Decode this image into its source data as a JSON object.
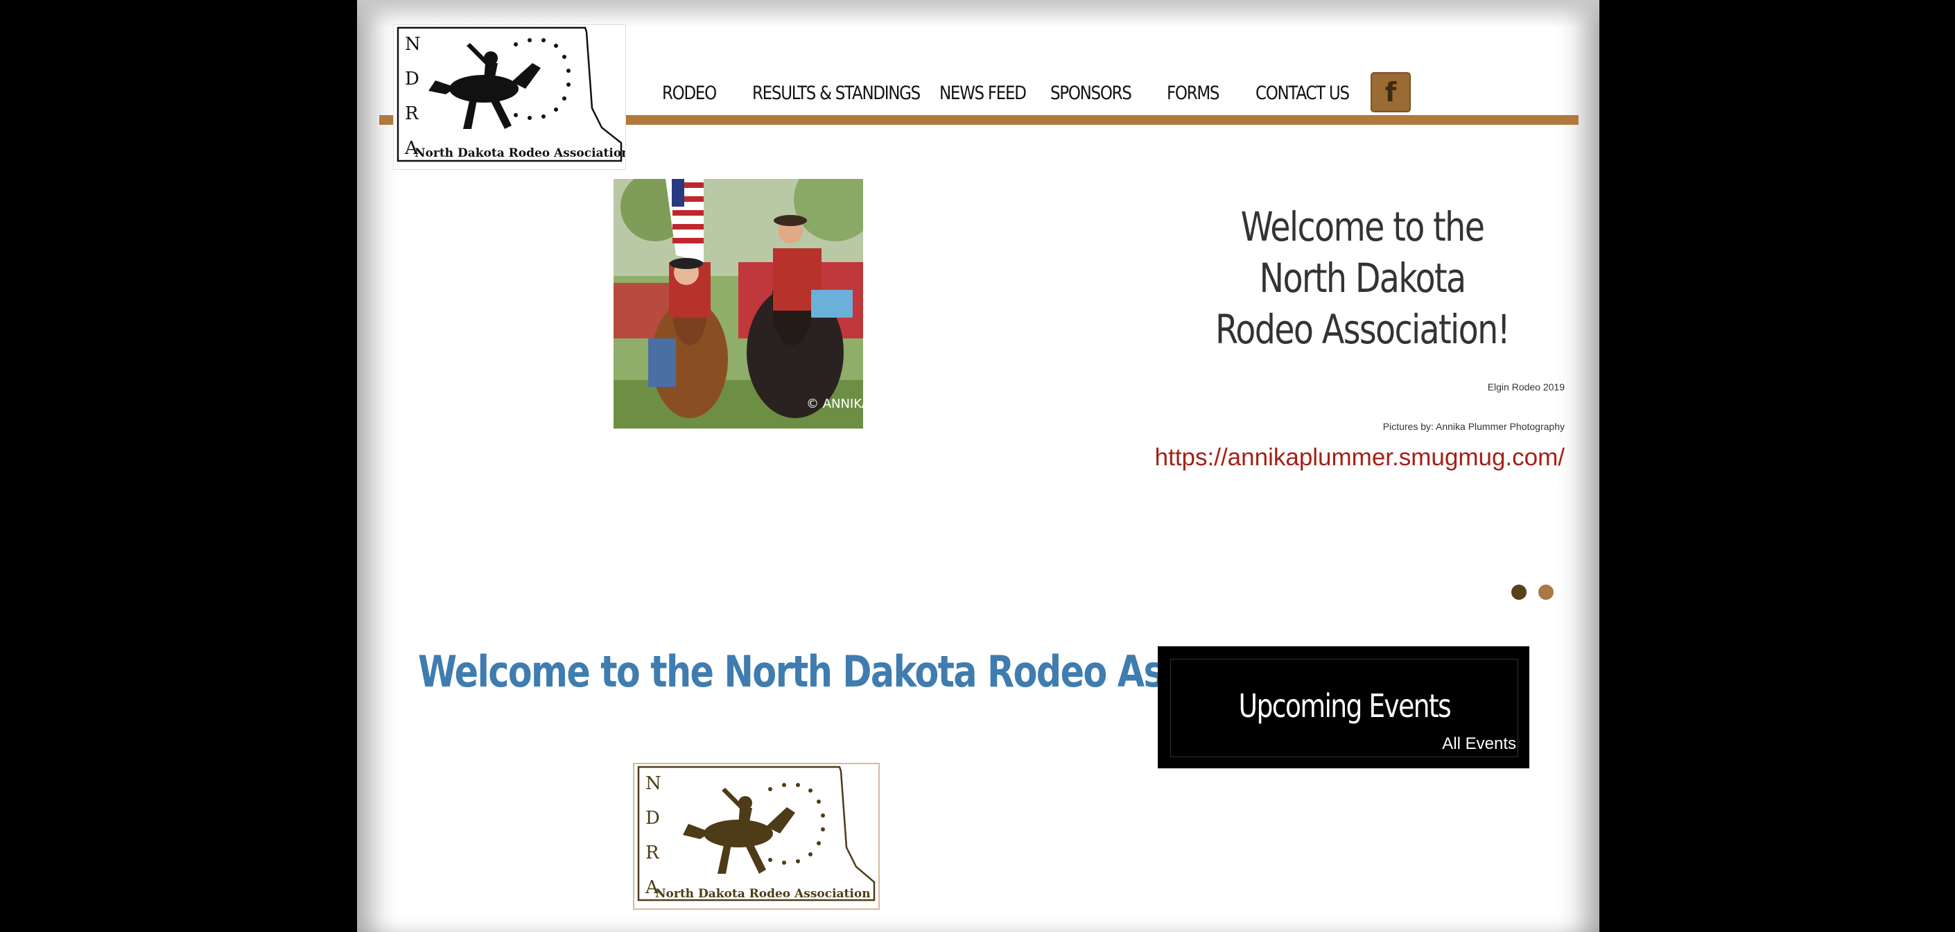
{
  "nav": {
    "items": [
      "RODEO",
      "RESULTS & STANDINGS",
      "NEWS FEED",
      "SPONSORS",
      "FORMS",
      "CONTACT US"
    ],
    "facebook_icon": "f"
  },
  "logo": {
    "letters": [
      "N",
      "D",
      "R",
      "A"
    ],
    "caption": "North Dakota Rodeo Association"
  },
  "hero": {
    "title_lines": [
      "Welcome to the",
      "North Dakota",
      "Rodeo Association!"
    ],
    "caption1": "Elgin Rodeo 2019",
    "caption2": "Pictures by: Annika Plummer Photography",
    "link": "https://annikaplummer.smugmug.com/",
    "photo_watermark": "© ANNIKA PHOTO",
    "slider_dots": 2
  },
  "main": {
    "heading": "Welcome to the North Dakota Rodeo Association"
  },
  "events": {
    "title": "Upcoming Events",
    "all_events": "All Events"
  },
  "colors": {
    "accent": "#b07a3e",
    "heading_blue": "#3f7cb0",
    "link_red": "#a52016",
    "dot_dark": "#5a4019",
    "dot_light": "#a87845"
  }
}
